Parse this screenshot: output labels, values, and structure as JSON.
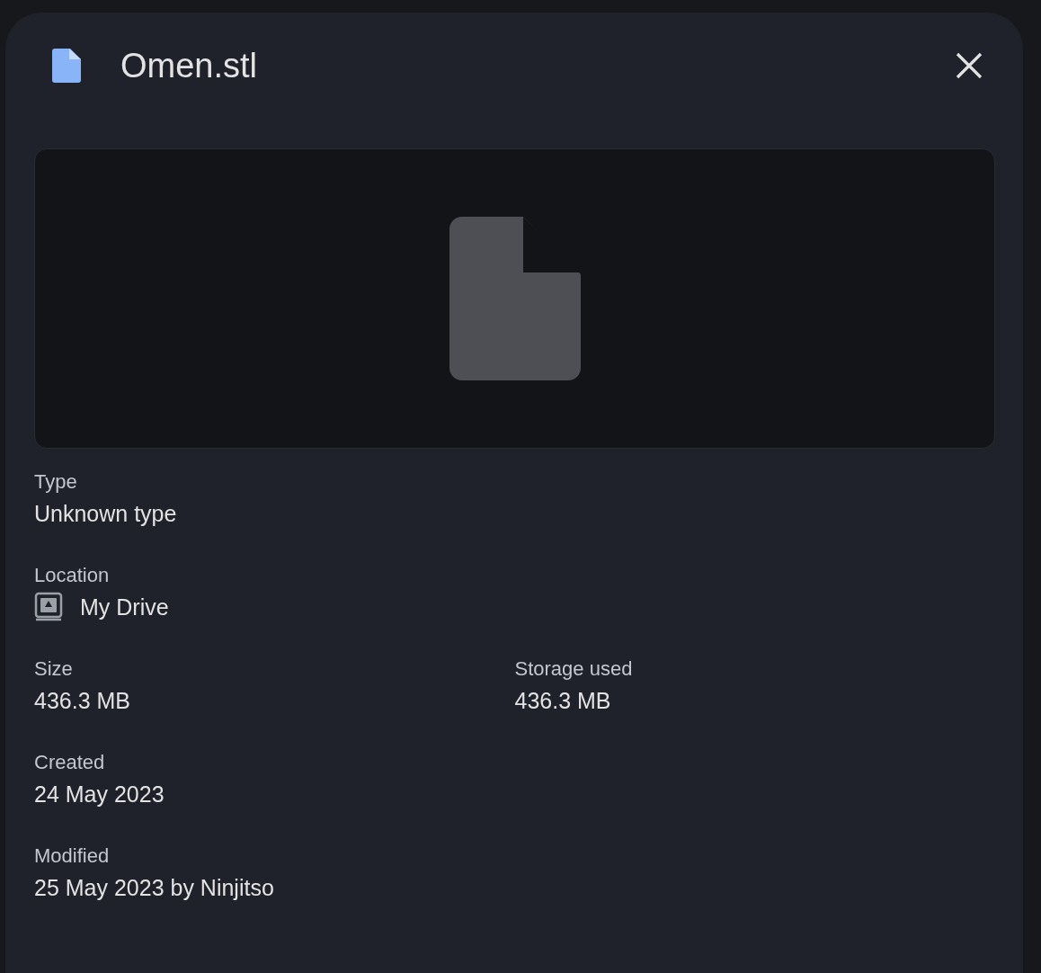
{
  "header": {
    "title": "Omen.stl"
  },
  "details": [
    {
      "fields": [
        {
          "kind": "text",
          "label": "Type",
          "value": "Unknown type"
        }
      ]
    },
    {
      "fields": [
        {
          "kind": "location",
          "label": "Location",
          "value": "My Drive"
        }
      ]
    },
    {
      "fields": [
        {
          "kind": "text",
          "label": "Size",
          "value": "436.3 MB"
        },
        {
          "kind": "text",
          "label": "Storage used",
          "value": "436.3 MB"
        }
      ]
    },
    {
      "fields": [
        {
          "kind": "text",
          "label": "Created",
          "value": "24 May 2023"
        }
      ]
    },
    {
      "fields": [
        {
          "kind": "text",
          "label": "Modified",
          "value": "25 May 2023 by Ninjitso"
        }
      ]
    }
  ]
}
